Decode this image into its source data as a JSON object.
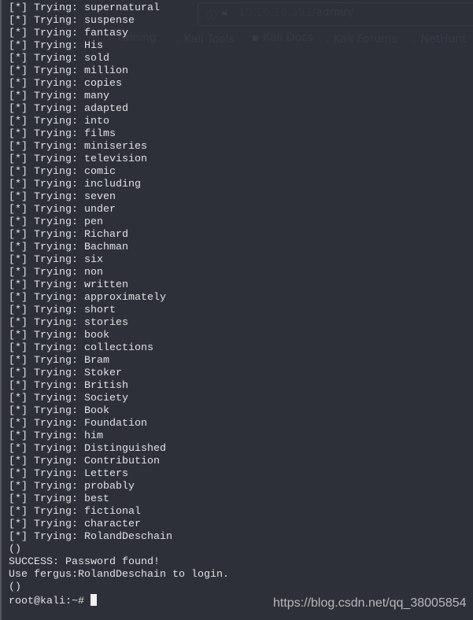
{
  "browser_overlay": {
    "url_host": "10.10.10.191",
    "url_path": "/admin/",
    "bookmarks": [
      "raining",
      "Kali Tools",
      "Kali Docs",
      "Kali Forums",
      "NetHunt"
    ]
  },
  "terminal": {
    "prefix": "[*] Trying: ",
    "attempts": [
      "supernatural",
      "suspense",
      "fantasy",
      "His",
      "sold",
      "million",
      "copies",
      "many",
      "adapted",
      "into",
      "films",
      "miniseries",
      "television",
      "comic",
      "including",
      "seven",
      "under",
      "pen",
      "Richard",
      "Bachman",
      "six",
      "non",
      "written",
      "approximately",
      "short",
      "stories",
      "book",
      "collections",
      "Bram",
      "Stoker",
      "British",
      "Society",
      "Book",
      "Foundation",
      "him",
      "Distinguished",
      "Contribution",
      "Letters",
      "probably",
      "best",
      "fictional",
      "character",
      "RolandDeschain"
    ],
    "tail": [
      "()",
      "SUCCESS: Password found!",
      "Use fergus:RolandDeschain to login.",
      "()"
    ],
    "prompt": "root@kali:~# "
  },
  "watermark": "https://blog.csdn.net/qq_38005854"
}
